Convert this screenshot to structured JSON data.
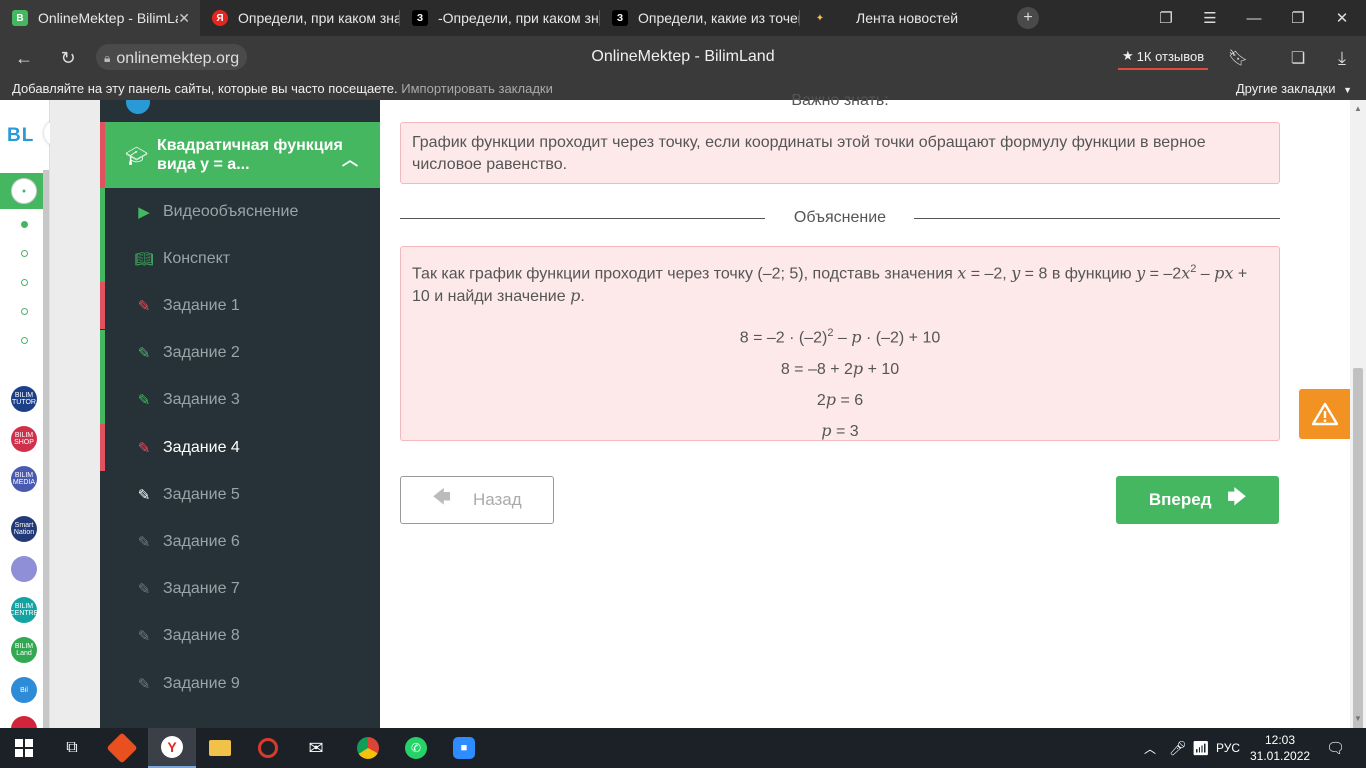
{
  "browser": {
    "tabs": [
      {
        "title": "OnlineMektep - BilimLand",
        "favicon": "B",
        "active": true
      },
      {
        "title": "Определи, при каком зна",
        "favicon": "Я",
        "active": false
      },
      {
        "title": "-Определи, при каком зна",
        "favicon": "З",
        "active": false
      },
      {
        "title": "Определи, какие из точек",
        "favicon": "З",
        "active": false
      },
      {
        "title": "Лента новостей",
        "favicon": "vk",
        "active": false
      }
    ],
    "url": "onlinemektep.org",
    "page_title": "OnlineMektep - BilimLand",
    "reviews": "1К отзывов",
    "bookmarks_hint": "Добавляйте на эту панель сайты, которые вы часто посещаете.",
    "bookmarks_import": "Импортировать закладки",
    "bookmarks_other": "Другие закладки"
  },
  "leftstrip": {
    "logo": "BL",
    "apps": [
      {
        "label": "BILIM\nTUTOR",
        "color": "#1c3f8a"
      },
      {
        "label": "BILIM\nSHOP",
        "color": "#d0304a"
      },
      {
        "label": "BILIM\nMEDIA",
        "color": "#4a5ab0"
      },
      {
        "label": "Smart\nNation",
        "color": "#233a78"
      },
      {
        "label": "",
        "color": "#8e8fd6"
      },
      {
        "label": "BILIM\nCENTRE",
        "color": "#13a3a3"
      },
      {
        "label": "BILIM\nLand",
        "color": "#33a852"
      },
      {
        "label": "Bil",
        "color": "#2e8bd8"
      },
      {
        "label": "",
        "color": "#d2243b"
      }
    ]
  },
  "course": {
    "chapter_title": "Квадратичная функция вида y = a...",
    "lessons": [
      {
        "label": "Видеообъяснение",
        "icon": "play-icon",
        "bar": "green",
        "state": "done"
      },
      {
        "label": "Конспект",
        "icon": "book-icon",
        "bar": "green",
        "state": "done"
      },
      {
        "label": "Задание 1",
        "icon": "edit-icon",
        "bar": "red",
        "state": "wrong"
      },
      {
        "label": "Задание 2",
        "icon": "edit-icon",
        "bar": "green",
        "state": "done"
      },
      {
        "label": "Задание 3",
        "icon": "edit-icon",
        "bar": "green",
        "state": "done"
      },
      {
        "label": "Задание 4",
        "icon": "edit-icon",
        "bar": "red",
        "state": "current"
      },
      {
        "label": "Задание 5",
        "icon": "edit-icon",
        "bar": "none",
        "state": "todo"
      },
      {
        "label": "Задание 6",
        "icon": "edit-icon",
        "bar": "none",
        "state": "todo"
      },
      {
        "label": "Задание 7",
        "icon": "edit-icon",
        "bar": "none",
        "state": "todo"
      },
      {
        "label": "Задание 8",
        "icon": "edit-icon",
        "bar": "none",
        "state": "todo"
      },
      {
        "label": "Задание 9",
        "icon": "edit-icon",
        "bar": "none",
        "state": "todo"
      }
    ]
  },
  "main": {
    "cut_header": "Важно знать:",
    "fact": "График функции проходит через точку, если координаты этой точки обращают формулу функции в верное числовое равенство.",
    "explanation_heading": "Объяснение",
    "explanation": {
      "p1": "Так как график функции проходит через точку (–2; 5), подставь значения ",
      "x": "x",
      "p2": " = –2, ",
      "y": "y",
      "p3": " = 8 в функцию ",
      "f_y": "y",
      "f_eq": " = –2",
      "f_x": "x",
      "f_sq": "2",
      "f_minus": " – ",
      "f_px": "px",
      "p4": " + 10 и найди значение ",
      "p": "p",
      "p5": "."
    },
    "equations": [
      {
        "a": "8 = –2 · (–2)",
        "sup": "2",
        "b": " – ",
        "var": "p",
        "c": " · (–2) + 10"
      },
      {
        "a": "8 = –8 + 2",
        "sup": "",
        "b": "",
        "var": "p",
        "c": " + 10"
      },
      {
        "a": "2",
        "sup": "",
        "b": "",
        "var": "p",
        "c": " = 6"
      },
      {
        "a": "",
        "sup": "",
        "b": "",
        "var": "p",
        "c": " = 3"
      }
    ],
    "back_label": "Назад",
    "next_label": "Вперед"
  },
  "taskbar": {
    "lang": "РУС",
    "time": "12:03",
    "date": "31.01.2022"
  },
  "colors": {
    "green": "#45b761",
    "red": "#e05260",
    "sidebar": "#263238",
    "box_bg": "#fde9ea",
    "warn": "#f29222"
  }
}
